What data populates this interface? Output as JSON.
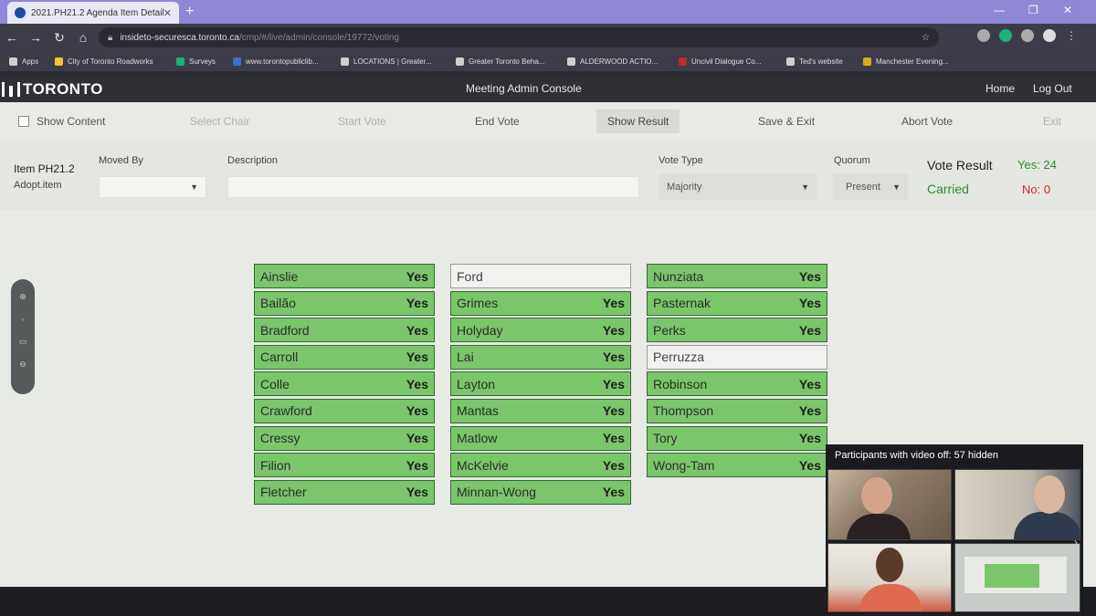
{
  "browser": {
    "tab_title": "2021.PH21.2 Agenda Item Detail",
    "url_host": "insideto-securesca.toronto.ca",
    "url_path": "/cmp/#/live/admin/console/19772/voting",
    "bookmarks": [
      {
        "label": "Apps",
        "color": "#cfcfcf"
      },
      {
        "label": "City of Toronto Roadworks",
        "color": "#f2c230"
      },
      {
        "label": "Surveys",
        "color": "#1bb37a"
      },
      {
        "label": "www.torontopubliclib...",
        "color": "#3a6fd8"
      },
      {
        "label": "LOCATIONS | Greater...",
        "color": "#cfcfcf"
      },
      {
        "label": "Greater Toronto Beha...",
        "color": "#cfcfcf"
      },
      {
        "label": "ALDERWOOD ACTIO...",
        "color": "#cfcfcf"
      },
      {
        "label": "Uncivil Dialogue Co...",
        "color": "#c0282d"
      },
      {
        "label": "Ted's website",
        "color": "#cfcfcf"
      },
      {
        "label": "Manchester Evening...",
        "color": "#e0a820"
      }
    ]
  },
  "app": {
    "logo_text": "TORONTO",
    "title": "Meeting Admin Console",
    "nav_home": "Home",
    "nav_logout": "Log Out"
  },
  "toolbar": {
    "show_content": "Show Content",
    "select_chair": "Select Chair",
    "start_vote": "Start Vote",
    "end_vote": "End Vote",
    "show_result": "Show Result",
    "save_exit": "Save & Exit",
    "abort_vote": "Abort Vote",
    "exit": "Exit"
  },
  "form": {
    "item_id": "Item PH21.2",
    "item_action": "Adopt.item",
    "moved_by_label": "Moved By",
    "moved_by_value": "",
    "description_label": "Description",
    "description_value": "",
    "vote_type_label": "Vote Type",
    "vote_type_value": "Majority",
    "quorum_label": "Quorum",
    "quorum_value": "Present",
    "vote_result_label": "Vote Result",
    "vote_result_status": "Carried",
    "yes_count": "Yes: 24",
    "no_count": "No: 0"
  },
  "votes": {
    "col1": [
      {
        "name": "Ainslie",
        "vote": "Yes"
      },
      {
        "name": "Bailão",
        "vote": "Yes"
      },
      {
        "name": "Bradford",
        "vote": "Yes"
      },
      {
        "name": "Carroll",
        "vote": "Yes"
      },
      {
        "name": "Colle",
        "vote": "Yes"
      },
      {
        "name": "Crawford",
        "vote": "Yes"
      },
      {
        "name": "Cressy",
        "vote": "Yes"
      },
      {
        "name": "Filion",
        "vote": "Yes"
      },
      {
        "name": "Fletcher",
        "vote": "Yes"
      }
    ],
    "col2": [
      {
        "name": "Ford",
        "vote": ""
      },
      {
        "name": "Grimes",
        "vote": "Yes"
      },
      {
        "name": "Holyday",
        "vote": "Yes"
      },
      {
        "name": "Lai",
        "vote": "Yes"
      },
      {
        "name": "Layton",
        "vote": "Yes"
      },
      {
        "name": "Mantas",
        "vote": "Yes"
      },
      {
        "name": "Matlow",
        "vote": "Yes"
      },
      {
        "name": "McKelvie",
        "vote": "Yes"
      },
      {
        "name": "Minnan-Wong",
        "vote": "Yes"
      }
    ],
    "col3": [
      {
        "name": "Nunziata",
        "vote": "Yes"
      },
      {
        "name": "Pasternak",
        "vote": "Yes"
      },
      {
        "name": "Perks",
        "vote": "Yes"
      },
      {
        "name": "Perruzza",
        "vote": ""
      },
      {
        "name": "Robinson",
        "vote": "Yes"
      },
      {
        "name": "Thompson",
        "vote": "Yes"
      },
      {
        "name": "Tory",
        "vote": "Yes"
      },
      {
        "name": "Wong-Tam",
        "vote": "Yes"
      }
    ]
  },
  "video": {
    "header": "Participants with video off: 57 hidden"
  }
}
